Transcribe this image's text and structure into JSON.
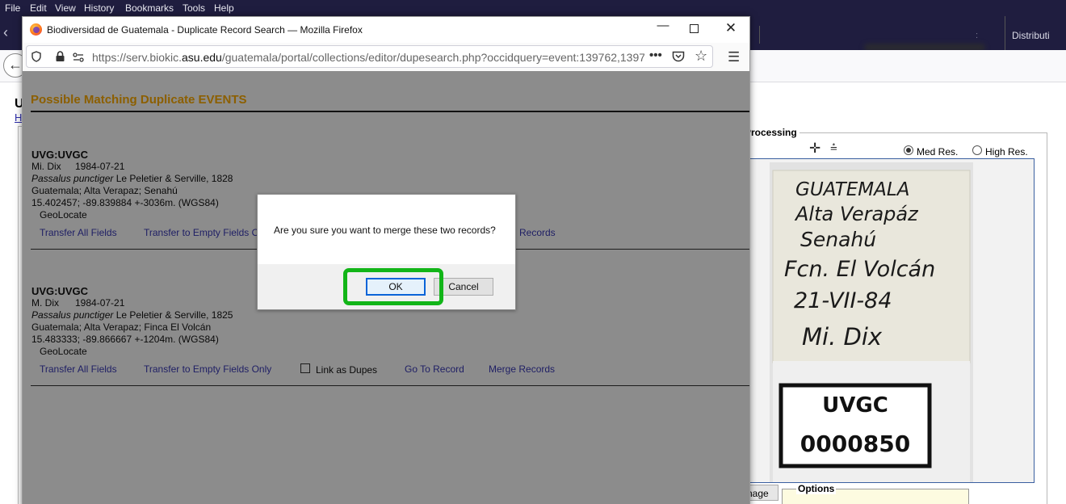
{
  "menubar": {
    "items": [
      "File",
      "Edit",
      "View",
      "History",
      "Bookmarks",
      "Tools",
      "Help"
    ]
  },
  "background_page": {
    "tab_label": "Distributi",
    "title_fragment": "U",
    "link_fragment": "H",
    "processing_legend": "Processing",
    "radio_med": "Med Res.",
    "radio_high": "High Res.",
    "image_button": "nage",
    "options_legend": "Options",
    "specimen_label": {
      "lines": [
        "GUATEMALA",
        "Alta Verapáz",
        "Senahú",
        "Fcn. El Volcán",
        "21-VII-84",
        "Mi. Dix"
      ],
      "tag_lines": [
        "UVGC",
        "0000850"
      ]
    }
  },
  "popup": {
    "title": "Biodiversidad de Guatemala - Duplicate Record Search — Mozilla Firefox",
    "url_prefix": "https://serv.biokic.",
    "url_domain": "asu.edu",
    "url_path": "/guatemala/portal/collections/editor/dupesearch.php?occidquery=event:139762,1397",
    "url_dots": "•••",
    "heading": "Possible Matching Duplicate EVENTS",
    "records": [
      {
        "title": "UVG:UVGC",
        "collector": "Mi. Dix",
        "date": "1984-07-21",
        "sciname": "Passalus punctiger",
        "author": "Le Peletier & Serville, 1828",
        "locality": "Guatemala; Alta Verapaz; Senahú",
        "coords": "15.402457; -89.839884 +-3036m. (WGS84)",
        "geolocate": "GeoLocate",
        "link_transfer_all": "Transfer All Fields",
        "link_transfer_empty": "Transfer to Empty Fields O",
        "link_merge": "Records"
      },
      {
        "title": "UVG:UVGC",
        "collector": "M. Dix",
        "date": "1984-07-21",
        "sciname": "Passalus punctiger",
        "author": "Le Peletier & Serville, 1825",
        "locality": "Guatemala; Alta Verapaz; Finca El Volcán",
        "coords": "15.483333; -89.866667 +-1204m. (WGS84)",
        "geolocate": "GeoLocate",
        "link_transfer_all": "Transfer All Fields",
        "link_transfer_empty": "Transfer to Empty Fields Only",
        "link_dupes": "Link as Dupes",
        "link_goto": "Go To Record",
        "link_merge": "Merge Records"
      }
    ]
  },
  "dialog": {
    "message": "Are you sure you want to merge these two records?",
    "ok": "OK",
    "cancel": "Cancel"
  },
  "colors": {
    "heading": "#ffad00",
    "link": "#3a3ab8",
    "highlight": "#12b518",
    "titlebar_dark": "#1f1d3f"
  }
}
